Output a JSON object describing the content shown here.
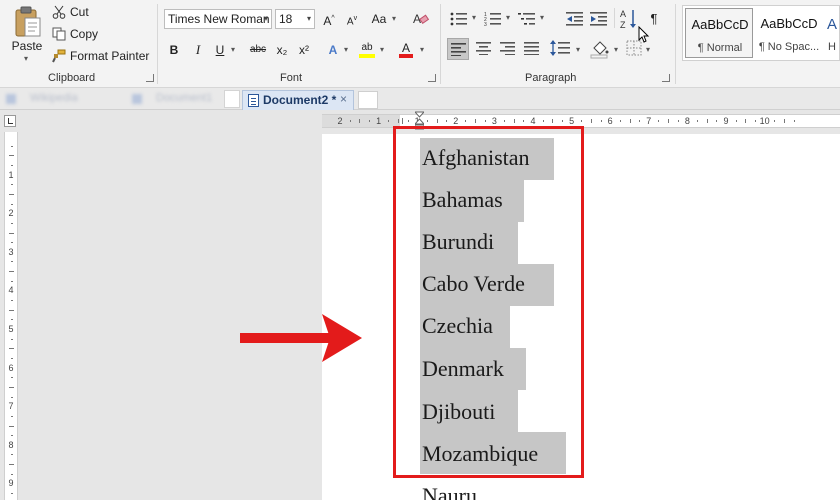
{
  "ribbon": {
    "clipboard": {
      "label": "Clipboard",
      "paste_label": "Paste",
      "cut_label": "Cut",
      "copy_label": "Copy",
      "format_painter_label": "Format Painter"
    },
    "font": {
      "label": "Font",
      "font_name": "Times New Roman",
      "font_size": "18",
      "grow_label": "A",
      "shrink_label": "A",
      "case_label": "Aa",
      "bold": "B",
      "italic": "I",
      "underline": "U",
      "strikethrough": "abc",
      "subscript": "x₂",
      "superscript": "x²",
      "text_effects": "A",
      "highlight": "ab",
      "font_color": "A"
    },
    "paragraph": {
      "label": "Paragraph",
      "pilcrow": "¶"
    },
    "styles": {
      "items": [
        {
          "preview": "AaBbCcD",
          "name": "¶ Normal"
        },
        {
          "preview": "AaBbCcD",
          "name": "¶ No Spac..."
        },
        {
          "preview": "A",
          "name": "H"
        }
      ]
    }
  },
  "tabs": {
    "blurred": [
      "Wikipedia",
      "Document1"
    ],
    "active": "Document2 *",
    "close_symbol": "×"
  },
  "ruler": {
    "h_numbers": [
      "2",
      "1",
      "1",
      "2",
      "3",
      "4",
      "5",
      "6",
      "7",
      "8",
      "9",
      "10"
    ],
    "v_numbers": [
      "1",
      "2",
      "3",
      "4",
      "5",
      "6",
      "7",
      "8",
      "9"
    ]
  },
  "document": {
    "lines": [
      "Afghanistan",
      "Bahamas",
      "Burundi",
      "Cabo Verde",
      "Czechia",
      "Denmark",
      "Djibouti",
      "Mozambique",
      "Nauru"
    ]
  },
  "colors": {
    "annotation_red": "#e31b1b",
    "selection_gray": "#c6c6c6"
  }
}
